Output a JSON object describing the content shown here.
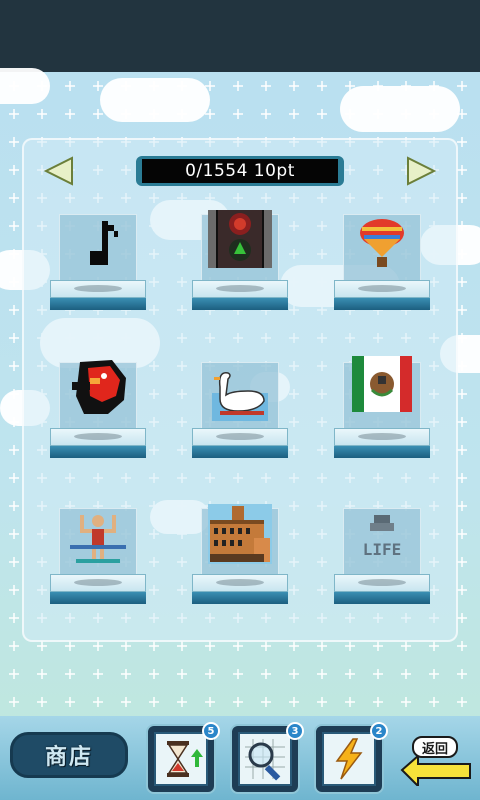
{
  "header": {
    "counter_text": "0/1554 10pt"
  },
  "navigation": {
    "prev_icon": "arrow-left-icon",
    "next_icon": "arrow-right-icon",
    "arrow_color": "#e8f0c8"
  },
  "grid": {
    "items": [
      {
        "icon": "music-note-icon"
      },
      {
        "icon": "traffic-light-icon"
      },
      {
        "icon": "hot-air-balloon-icon"
      },
      {
        "icon": "red-bird-icon"
      },
      {
        "icon": "swan-boat-icon"
      },
      {
        "icon": "mexico-flag-icon"
      },
      {
        "icon": "gymnast-icon"
      },
      {
        "icon": "castle-building-icon"
      },
      {
        "icon": "life-gravestone-icon",
        "label": "LIFE"
      }
    ]
  },
  "toolbar": {
    "shop_label": "商店",
    "items": [
      {
        "icon": "hourglass-up-icon",
        "count": "5"
      },
      {
        "icon": "magnifier-grid-icon",
        "count": "3"
      },
      {
        "icon": "lightning-icon",
        "count": "2"
      }
    ],
    "back_label": "返回"
  },
  "colors": {
    "topbar": "#22343f",
    "counter_frame": "#2b7c95",
    "pedestal_base": "#1c5f80",
    "badge": "#2a86c9"
  }
}
